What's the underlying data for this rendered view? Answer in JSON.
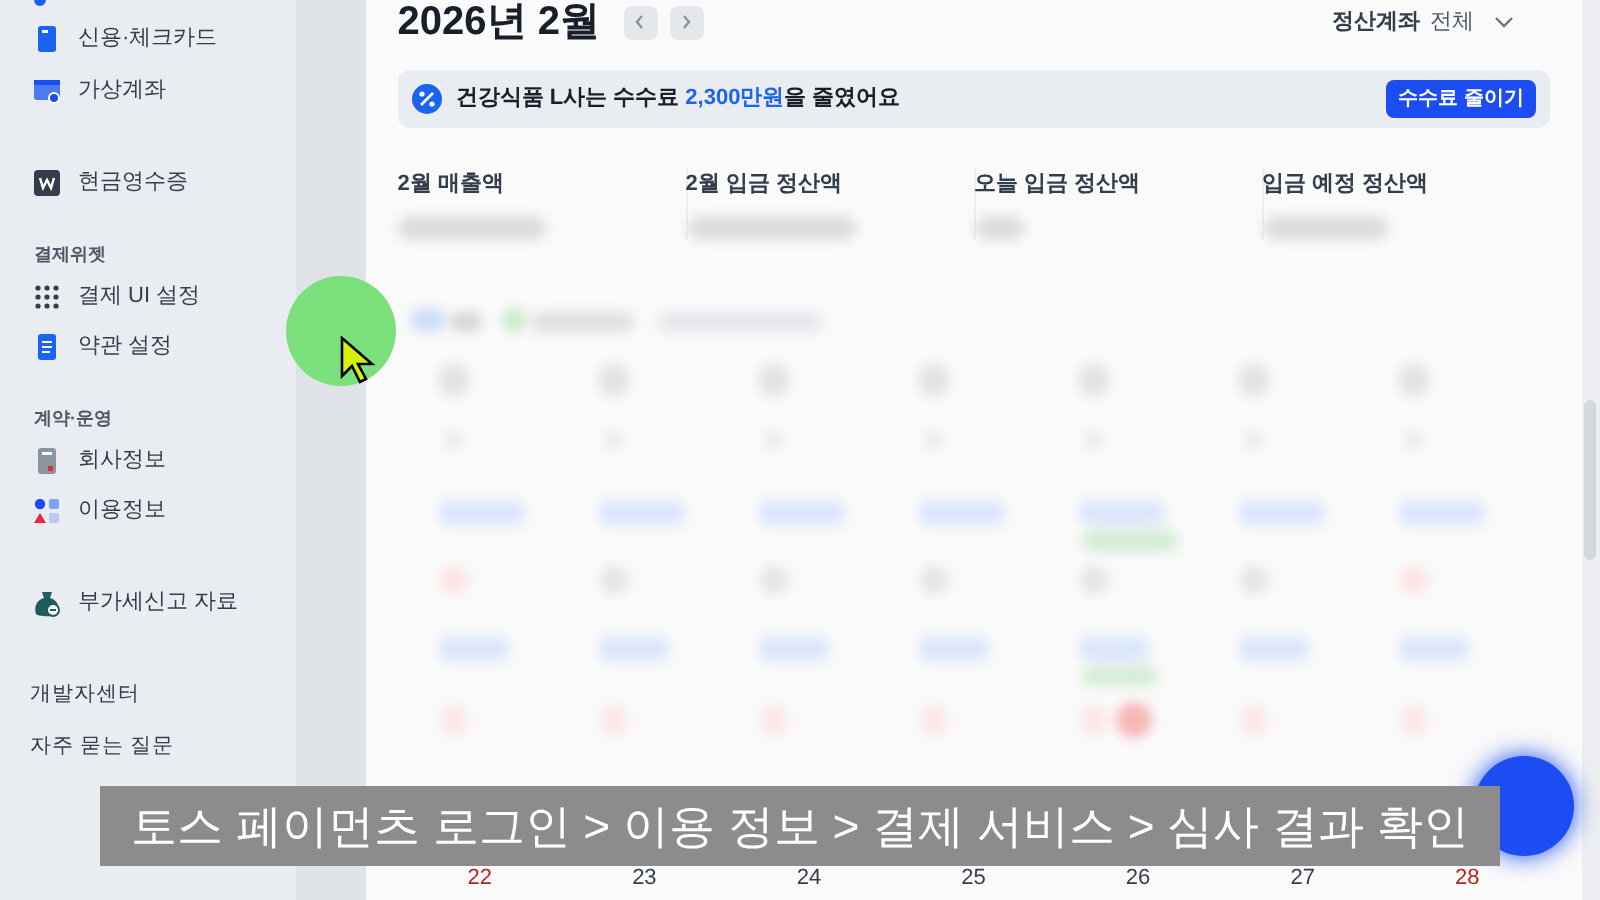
{
  "sidebar": {
    "items": [
      {
        "kind": "item",
        "label": "신용·체크카드"
      },
      {
        "kind": "item",
        "label": "가상계좌"
      },
      {
        "kind": "item",
        "label": "현금영수증"
      },
      {
        "kind": "section",
        "label": "결제위젯"
      },
      {
        "kind": "item",
        "label": "결제 UI 설정"
      },
      {
        "kind": "item",
        "label": "약관 설정"
      },
      {
        "kind": "section",
        "label": "계약·운영"
      },
      {
        "kind": "item",
        "label": "회사정보"
      },
      {
        "kind": "item",
        "label": "이용정보"
      },
      {
        "kind": "item",
        "label": "부가세신고 자료"
      },
      {
        "kind": "link",
        "label": "개발자센터"
      },
      {
        "kind": "link",
        "label": "자주 묻는 질문"
      }
    ]
  },
  "header": {
    "title": "2026년 2월",
    "account_label": "정산계좌",
    "account_value": "전체"
  },
  "banner": {
    "text": "건강식품 L사는 수수료 **2,300만원**을 줄였어요",
    "button": "수수료 줄이기"
  },
  "stats": [
    {
      "label": "2월 매출액"
    },
    {
      "label": "2월 입금 정산액"
    },
    {
      "label": "오늘 입금 정산액"
    },
    {
      "label": "입금 예정 정산액"
    }
  ],
  "calendar": {
    "last_row": [
      {
        "label": "22",
        "weekend": true
      },
      {
        "label": "23",
        "weekend": false
      },
      {
        "label": "24",
        "weekend": false
      },
      {
        "label": "25",
        "weekend": false
      },
      {
        "label": "26",
        "weekend": false
      },
      {
        "label": "27",
        "weekend": false
      },
      {
        "label": "28",
        "weekend": true
      }
    ]
  },
  "caption": "토스 페이먼츠 로그인 > 이용 정보 > 결제 서비스 > 심사 결과 확인"
}
